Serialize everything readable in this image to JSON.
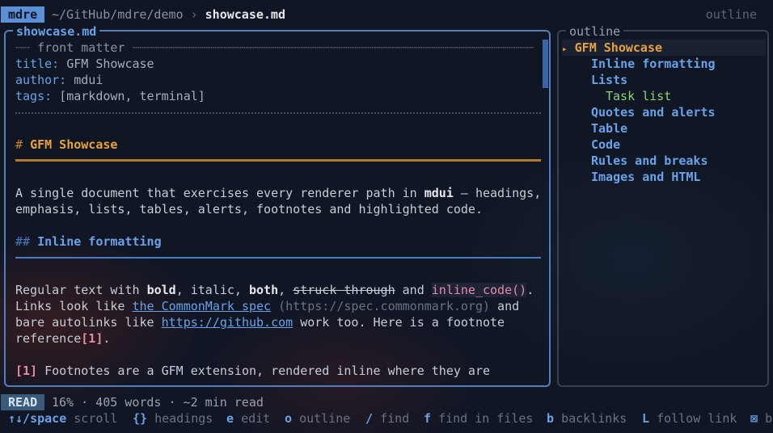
{
  "topbar": {
    "app_name": "mdre",
    "path": "~/GitHub/mdre/demo",
    "separator": "›",
    "file": "showcase.md",
    "right_label": "outline"
  },
  "document": {
    "pane_title": "showcase.md",
    "front_matter_label": "front matter",
    "front_matter": [
      {
        "key": "title:",
        "value": "GFM Showcase"
      },
      {
        "key": "author:",
        "value": "mdui"
      },
      {
        "key": "tags:",
        "value": "[markdown, terminal]"
      }
    ],
    "h1_mark": "#",
    "h1": "GFM Showcase",
    "intro": {
      "l1_a": "A single document that exercises every renderer path in ",
      "l1_b": "mdui",
      "l1_c": " — headings,",
      "l2": "emphasis, lists, tables, alerts, footnotes and highlighted code."
    },
    "h2_mark": "##",
    "h2": "Inline formatting",
    "para": {
      "p1_a": "Regular text with ",
      "p1_bold": "bold",
      "p1_b": ", italic, ",
      "p1_both": "both",
      "p1_c": ", ",
      "p1_strike": "struck through",
      "p1_d": " and ",
      "p1_code": "inline_code()",
      "p1_e": ".",
      "p2_a": "Links look like ",
      "p2_link": "the CommonMark spec",
      "p2_url": " (https://spec.commonmark.org)",
      "p2_b": " and",
      "p3_a": "bare autolinks like ",
      "p3_link": "https://github.com",
      "p3_b": " work too. Here is a footnote",
      "p4_a": "reference",
      "p4_ref": "[1]",
      "p4_b": "."
    },
    "footnote_ref": "[1]",
    "footnote_text": " Footnotes are a GFM extension, rendered inline where they are"
  },
  "outline": {
    "title": "outline",
    "arrow": "▸",
    "items": [
      {
        "label": "GFM Showcase",
        "level": 1
      },
      {
        "label": "Inline formatting",
        "level": 2
      },
      {
        "label": "Lists",
        "level": 2
      },
      {
        "label": "Task list",
        "level": 3
      },
      {
        "label": "Quotes and alerts",
        "level": 2
      },
      {
        "label": "Table",
        "level": 2
      },
      {
        "label": "Code",
        "level": 2
      },
      {
        "label": "Rules and breaks",
        "level": 2
      },
      {
        "label": "Images and HTML",
        "level": 2
      }
    ]
  },
  "status": {
    "mode": "READ",
    "info": "16% · 405 words · ~2 min read",
    "progress_percent": 16
  },
  "keybar": [
    {
      "key": "↑↓/space",
      "action": "scroll"
    },
    {
      "key": "{}",
      "action": "headings"
    },
    {
      "key": "e",
      "action": "edit"
    },
    {
      "key": "o",
      "action": "outline"
    },
    {
      "key": "/",
      "action": "find"
    },
    {
      "key": "f",
      "action": "find in files"
    },
    {
      "key": "b",
      "action": "backlinks"
    },
    {
      "key": "L",
      "action": "follow link"
    },
    {
      "key": "⊠",
      "action": "b"
    }
  ],
  "colors": {
    "accent_blue": "#6aa2e8",
    "heading_orange": "#e8a23a",
    "code_pink": "#e68aa6",
    "task_green": "#8fd17a",
    "background": "#101624"
  }
}
